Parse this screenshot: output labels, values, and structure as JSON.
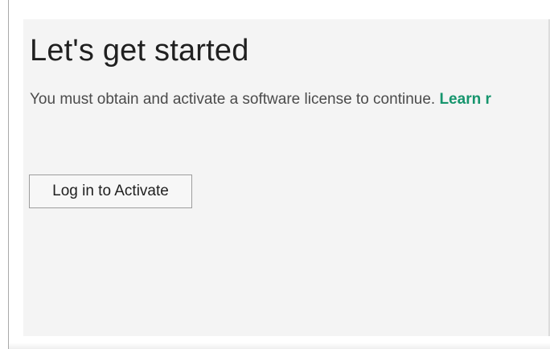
{
  "page": {
    "title": "Let's get started",
    "message": "You must obtain and activate a software license to continue.",
    "learn_more_label": "Learn r",
    "activate_button_label": "Log in to Activate"
  },
  "colors": {
    "panel_background": "#f4f4f4",
    "link_color": "#16956d",
    "button_border": "#9d9d9d"
  }
}
